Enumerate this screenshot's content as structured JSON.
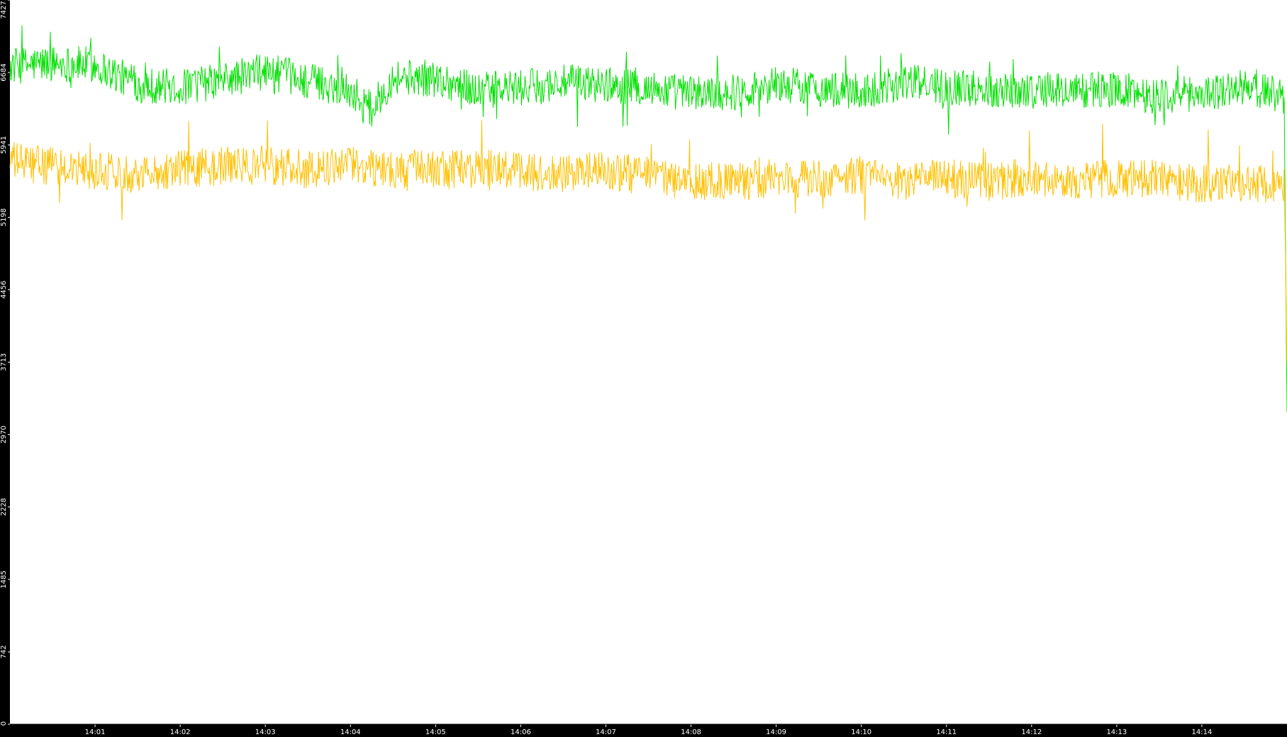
{
  "chart_data": {
    "type": "line",
    "title": "",
    "xlabel": "",
    "ylabel": "",
    "ylim": [
      0,
      7427
    ],
    "xlim": [
      "14:00:00",
      "14:15:00"
    ],
    "yticks": [
      0,
      742,
      1485,
      2228,
      2970,
      3713,
      4456,
      5198,
      5941,
      6684,
      7427
    ],
    "xticks": [
      "14:01",
      "14:02",
      "14:03",
      "14:04",
      "14:05",
      "14:06",
      "14:07",
      "14:08",
      "14:09",
      "14:10",
      "14:11",
      "14:12",
      "14:13",
      "14:14"
    ],
    "grid": false,
    "legend": "none",
    "background": "#ffffff",
    "series": [
      {
        "color": "#00e000",
        "x": [
          "14:00:00",
          "14:00:30",
          "14:01:00",
          "14:01:30",
          "14:02:00",
          "14:02:30",
          "14:03:00",
          "14:03:30",
          "14:04:00",
          "14:04:15",
          "14:04:30",
          "14:05:00",
          "14:05:30",
          "14:06:00",
          "14:06:30",
          "14:07:00",
          "14:07:30",
          "14:08:00",
          "14:08:30",
          "14:09:00",
          "14:09:30",
          "14:10:00",
          "14:10:30",
          "14:11:00",
          "14:11:30",
          "14:12:00",
          "14:12:30",
          "14:13:00",
          "14:13:30",
          "14:14:00",
          "14:14:30",
          "14:14:58",
          "14:15:00"
        ],
        "values": [
          6750,
          6780,
          6760,
          6560,
          6530,
          6600,
          6700,
          6600,
          6500,
          6300,
          6640,
          6620,
          6500,
          6520,
          6580,
          6560,
          6520,
          6470,
          6480,
          6570,
          6520,
          6480,
          6590,
          6540,
          6510,
          6500,
          6500,
          6510,
          6440,
          6470,
          6530,
          6450,
          3200
        ],
        "noise": 190
      },
      {
        "color": "#ffc000",
        "x": [
          "14:00:00",
          "14:00:30",
          "14:01:00",
          "14:01:30",
          "14:02:00",
          "14:02:30",
          "14:03:00",
          "14:03:30",
          "14:04:00",
          "14:04:30",
          "14:05:00",
          "14:05:30",
          "14:06:00",
          "14:06:30",
          "14:07:00",
          "14:07:30",
          "14:08:00",
          "14:08:30",
          "14:09:00",
          "14:09:30",
          "14:10:00",
          "14:10:30",
          "14:11:00",
          "14:11:30",
          "14:12:00",
          "14:12:30",
          "14:13:00",
          "14:13:30",
          "14:14:00",
          "14:14:30",
          "14:14:58",
          "14:15:00"
        ],
        "values": [
          5780,
          5720,
          5680,
          5650,
          5700,
          5720,
          5740,
          5690,
          5730,
          5700,
          5680,
          5700,
          5660,
          5640,
          5680,
          5620,
          5570,
          5560,
          5600,
          5580,
          5620,
          5560,
          5600,
          5560,
          5620,
          5580,
          5600,
          5590,
          5540,
          5560,
          5520,
          3700
        ],
        "noise": 200
      }
    ]
  }
}
